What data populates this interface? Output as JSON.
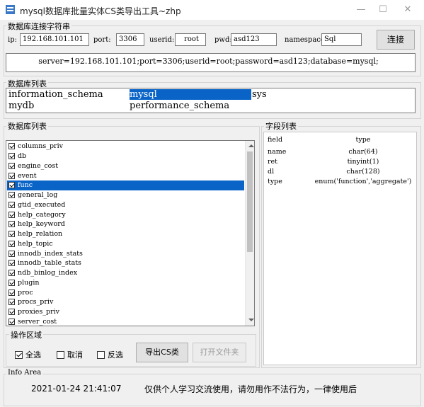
{
  "window": {
    "title": "mysql数据库批量实体CS类导出工具~zhp"
  },
  "connection": {
    "group_label": "数据库连接字符串",
    "ip_label": "ip:",
    "ip_value": "192.168.101.101",
    "port_label": "port:",
    "port_value": "3306",
    "userid_label": "userid:",
    "userid_value": "root",
    "pwd_label": "pwd:",
    "pwd_value": "asd123",
    "namespace_label": "namespace:",
    "namespace_value": "Sql",
    "connect_button": "连接",
    "connection_string": "server=192.168.101.101;port=3306;userid=root;password=asd123;database=mysql;"
  },
  "databases": {
    "group_label": "数据库列表",
    "items": [
      "information_schema",
      "mysql",
      "sys",
      "mydb",
      "performance_schema"
    ],
    "selected": "mysql"
  },
  "tables": {
    "group_label": "数据库列表",
    "selected": "func",
    "items": [
      "columns_priv",
      "db",
      "engine_cost",
      "event",
      "func",
      "general_log",
      "gtid_executed",
      "help_category",
      "help_keyword",
      "help_relation",
      "help_topic",
      "innodb_index_stats",
      "innodb_table_stats",
      "ndb_binlog_index",
      "plugin",
      "proc",
      "procs_priv",
      "proxies_priv",
      "server_cost"
    ]
  },
  "fields": {
    "group_label": "字段列表",
    "header_field": "field",
    "header_type": "type",
    "rows": [
      {
        "field": "name",
        "type": "char(64)"
      },
      {
        "field": "ret",
        "type": "tinyint(1)"
      },
      {
        "field": "dl",
        "type": "char(128)"
      },
      {
        "field": "type",
        "type": "enum('function','aggregate')"
      }
    ]
  },
  "operations": {
    "group_label": "操作区域",
    "select_all": "全选",
    "select_all_checked": true,
    "cancel": "取消",
    "invert": "反选",
    "export_button": "导出CS类",
    "open_folder_button": "打开文件夹"
  },
  "info": {
    "group_label": "Info Area",
    "timestamp": "2021-01-24 21:41:07",
    "message": "仅供个人学习交流使用，请勿用作不法行为，一律使用后"
  },
  "colors": {
    "selection": "#0a64c8",
    "window_bg": "#f0f0f0"
  }
}
